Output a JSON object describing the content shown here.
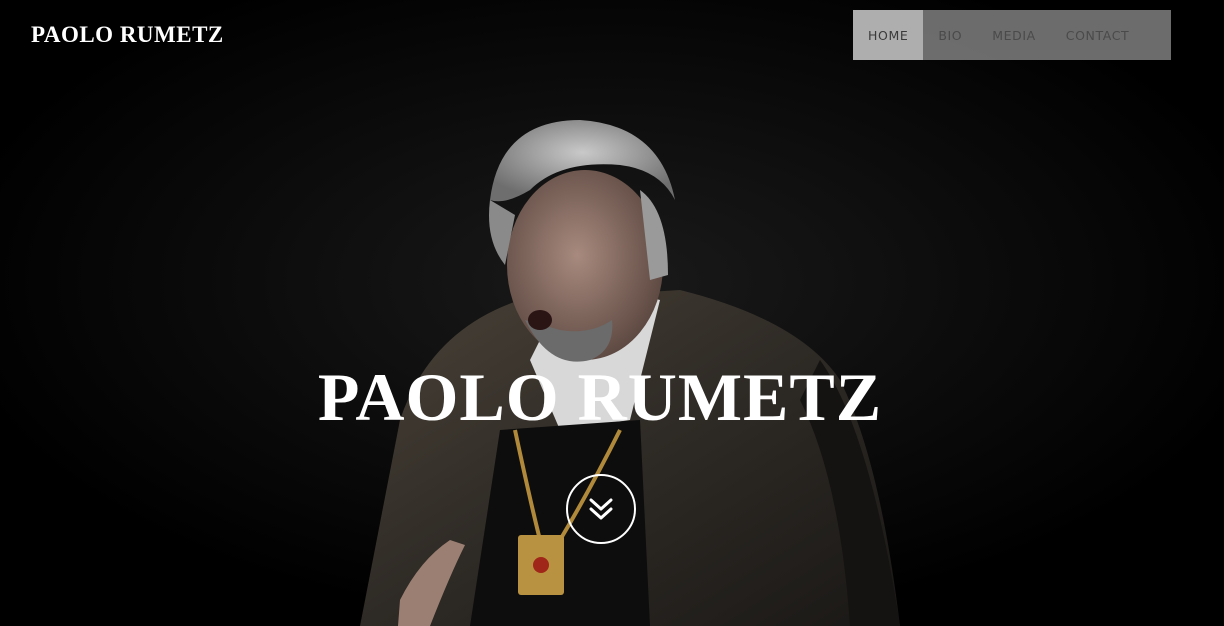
{
  "brand": {
    "logo_text": "PAOLO RUMETZ"
  },
  "nav": {
    "items": [
      {
        "label": "HOME",
        "active": true
      },
      {
        "label": "BIO",
        "active": false
      },
      {
        "label": "MEDIA",
        "active": false
      },
      {
        "label": "CONTACT",
        "active": false
      }
    ]
  },
  "hero": {
    "title": "PAOLO RUMETZ",
    "image": "performer-in-fur-costume-photo",
    "scroll_icon": "double-chevron-down-icon"
  },
  "colors": {
    "background": "#000000",
    "text": "#ffffff",
    "nav_bg": "#969696",
    "nav_active_bg": "#b2b2b2",
    "nav_text": "#4a4a4a"
  }
}
